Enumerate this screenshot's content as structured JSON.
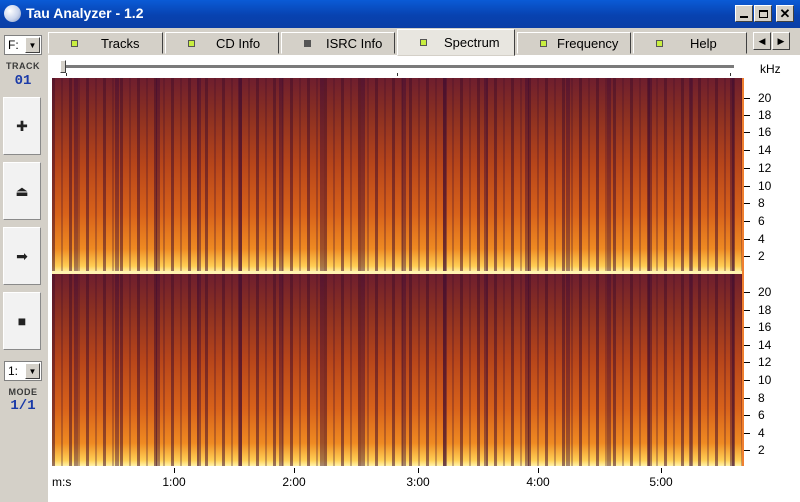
{
  "window": {
    "title": "Tau Analyzer - 1.2"
  },
  "left_panel": {
    "drive": "F:",
    "track_label": "TRACK",
    "track_value": "01",
    "buttons": [
      {
        "icon": "plus-icon",
        "glyph": "✚"
      },
      {
        "icon": "eject-icon",
        "glyph": "⏏"
      },
      {
        "icon": "arrow-right-icon",
        "glyph": "➡"
      },
      {
        "icon": "stop-icon",
        "glyph": "■"
      }
    ],
    "mode_select": "1:",
    "mode_label": "MODE",
    "mode_value": "1/1"
  },
  "tabs": [
    {
      "label": "Tracks",
      "led": "#c8ee40",
      "active": false
    },
    {
      "label": "CD Info",
      "led": "#c8ee40",
      "active": false
    },
    {
      "label": "ISRC Info",
      "led": "#555555",
      "active": false
    },
    {
      "label": "Spectrum",
      "led": "#c8ee40",
      "active": true
    },
    {
      "label": "Frequency",
      "led": "#c8ee40",
      "active": false
    },
    {
      "label": "Help",
      "led": "#c8ee40",
      "active": false
    }
  ],
  "spectrum": {
    "unit": "kHz",
    "freq_ticks": [
      "20",
      "18",
      "16",
      "14",
      "12",
      "10",
      "8",
      "6",
      "4",
      "2"
    ],
    "time_unit": "m:s",
    "time_ticks": [
      "1:00",
      "2:00",
      "3:00",
      "4:00",
      "5:00"
    ],
    "colors": {
      "low": "#5a1a3a",
      "mid": "#c8501a",
      "high": "#fff2a8"
    }
  }
}
